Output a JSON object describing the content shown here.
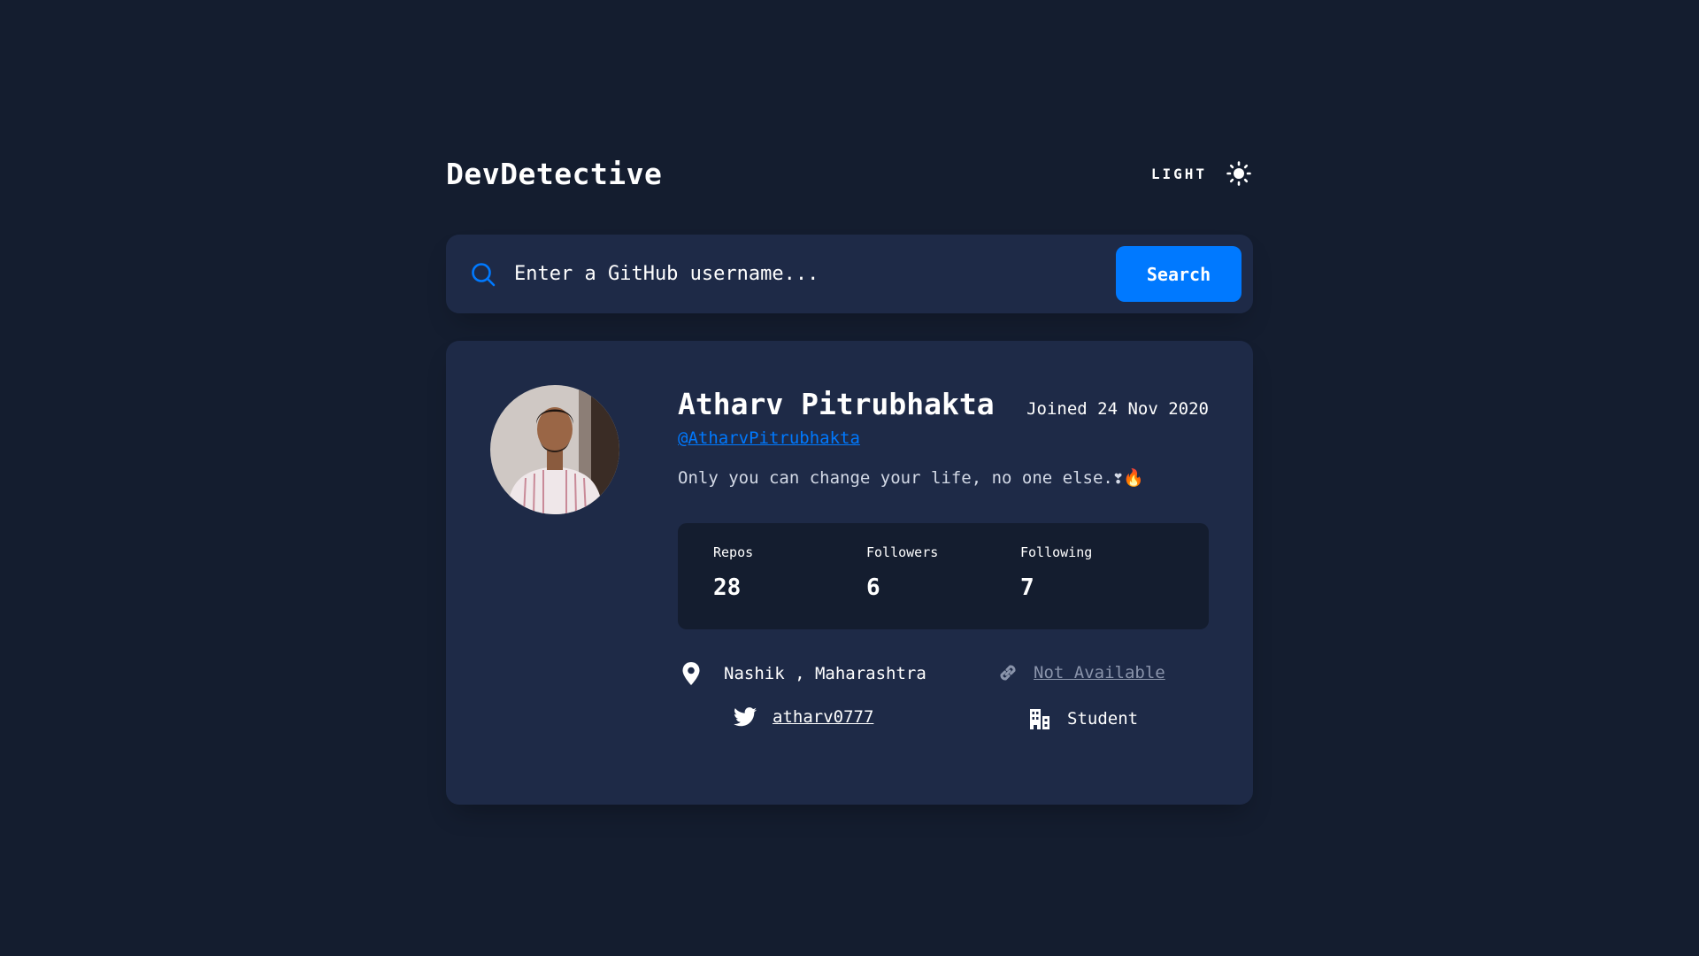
{
  "app": {
    "brand": "DevDetective",
    "theme_toggle_label": "LIGHT",
    "theme_icon": "sun-icon"
  },
  "search": {
    "placeholder": "Enter a GitHub username...",
    "value": "",
    "button_label": "Search",
    "icon": "search-icon"
  },
  "profile": {
    "avatar_icon": "avatar",
    "name": "Atharv Pitrubhakta",
    "joined": "Joined 24 Nov 2020",
    "login": "@AtharvPitrubhakta",
    "bio": "Only you can change your life, no one else.❣🔥",
    "stats": {
      "repos_label": "Repos",
      "repos": "28",
      "followers_label": "Followers",
      "followers": "6",
      "following_label": "Following",
      "following": "7"
    },
    "location": "Nashik , Maharashtra",
    "blog": "Not Available",
    "twitter": "atharv0777",
    "company": "Student"
  },
  "colors": {
    "background": "#141d2f",
    "card": "#1e2a47",
    "accent": "#0079ff",
    "text": "#ffffff",
    "muted": "#8a94ab"
  }
}
